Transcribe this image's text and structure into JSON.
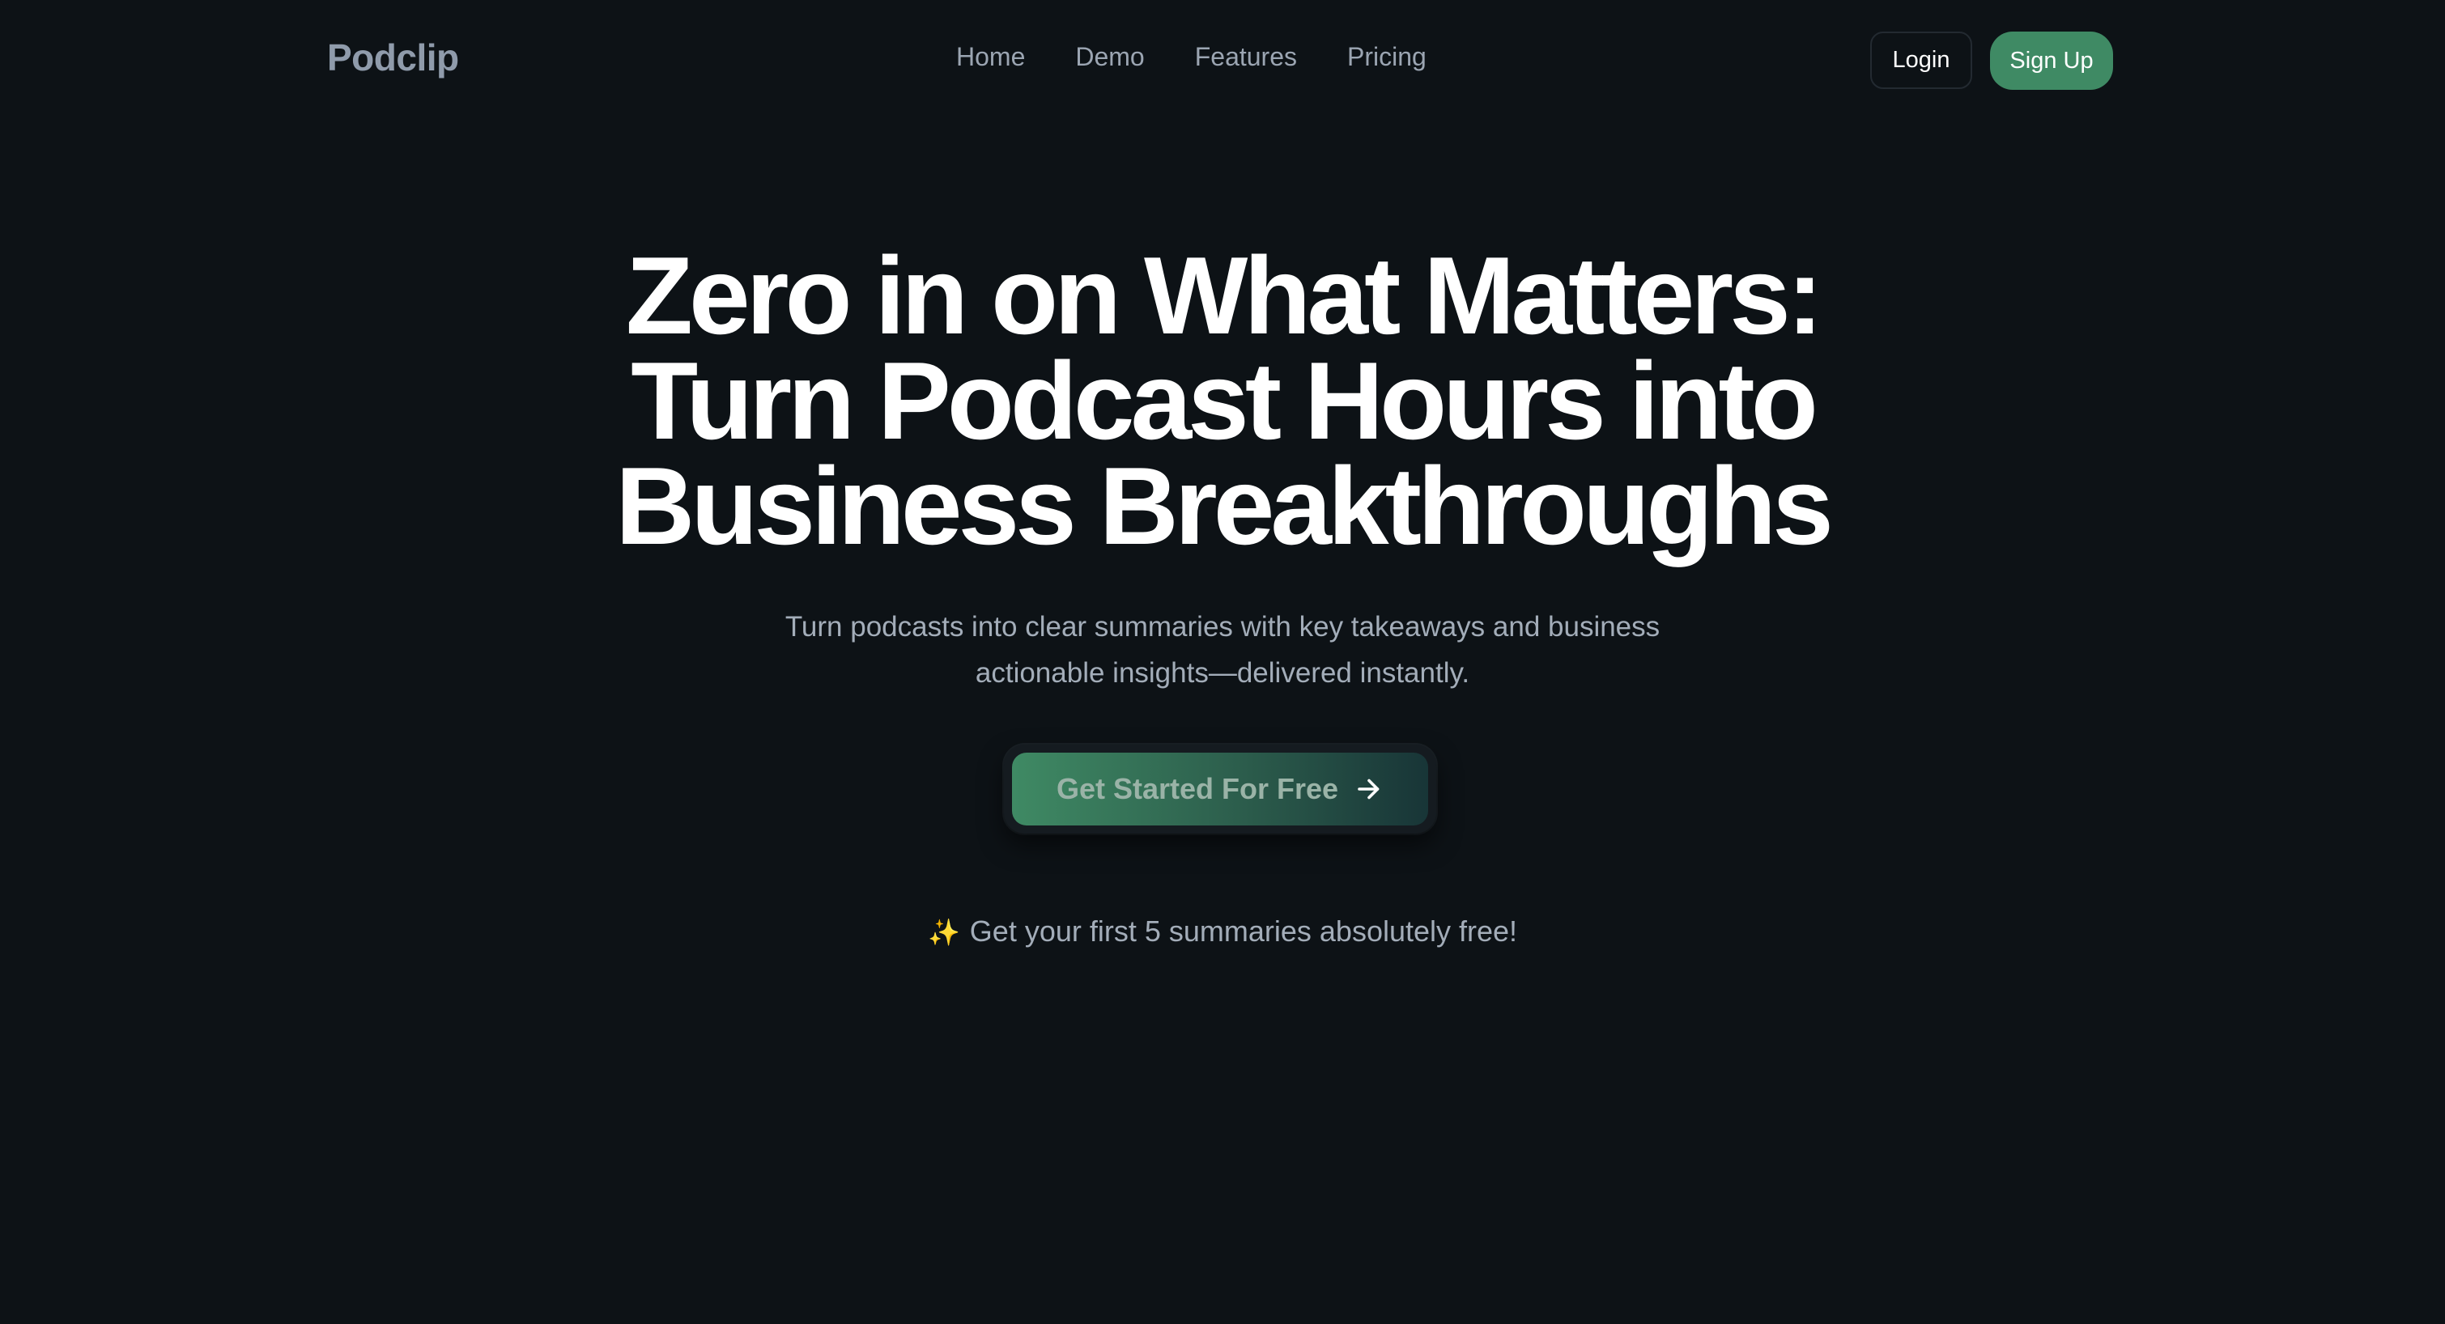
{
  "nav": {
    "brand": "Podclip",
    "links": [
      "Home",
      "Demo",
      "Features",
      "Pricing"
    ],
    "login_label": "Login",
    "signup_label": "Sign Up"
  },
  "hero": {
    "title_lines": [
      "Zero in on What Matters:",
      "Turn Podcast Hours into",
      "Business Breakthroughs"
    ],
    "subtitle_lines": [
      "Turn podcasts into clear summaries with key takeaways and business",
      "actionable insights—delivered instantly."
    ],
    "cta_label": "Get Started For Free",
    "free_note": "Get your first 5 summaries absolutely free!"
  },
  "icons": {
    "cta_arrow": "arrow-right-icon",
    "free_note": "sparkles-icon"
  },
  "colors": {
    "background": "#0d1216",
    "accent": "#3f8a64",
    "brand_text": "#8f9bab"
  }
}
